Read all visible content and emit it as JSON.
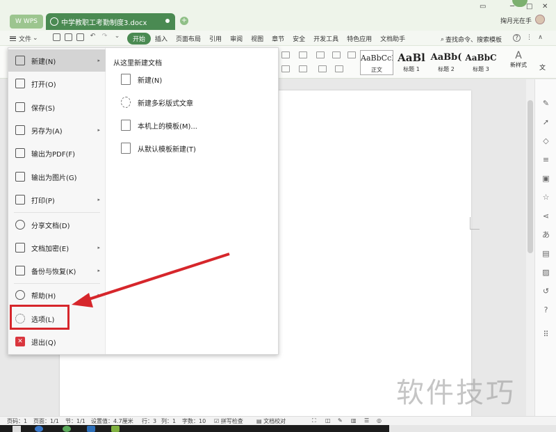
{
  "titlebar": {
    "wps_label": "WPS",
    "doc_tab_title": "中学教职工考勤制度3.docx",
    "add_tab": "+",
    "user_name": "掬月光在手",
    "win_min": "─",
    "win_max": "□",
    "win_close": "✕"
  },
  "menu": {
    "file_label": "文件",
    "tabs": [
      "开始",
      "插入",
      "页面布局",
      "引用",
      "审阅",
      "视图",
      "章节",
      "安全",
      "开发工具",
      "特色应用",
      "文档助手"
    ],
    "search_label": "查找命令、搜索模板",
    "help": "?",
    "more": "文"
  },
  "ribbon": {
    "styles": [
      {
        "preview": "AaBbCcDd",
        "caption": "正文"
      },
      {
        "preview": "AaBl",
        "caption": "标题 1"
      },
      {
        "preview": "AaBb(",
        "caption": "标题 2"
      },
      {
        "preview": "AaBbC",
        "caption": "标题 3"
      }
    ],
    "new_style": {
      "icon": "A",
      "caption": "新样式"
    }
  },
  "file_menu": {
    "items": [
      {
        "label": "新建(N)",
        "icon": "new-doc-icon",
        "arrow": true
      },
      {
        "label": "打开(O)",
        "icon": "folder-icon",
        "arrow": false
      },
      {
        "label": "保存(S)",
        "icon": "save-icon",
        "arrow": false
      },
      {
        "label": "另存为(A)",
        "icon": "save-as-icon",
        "arrow": true
      },
      {
        "label": "输出为PDF(F)",
        "icon": "pdf-icon",
        "arrow": false
      },
      {
        "label": "输出为图片(G)",
        "icon": "image-icon",
        "arrow": false
      },
      {
        "label": "打印(P)",
        "icon": "print-icon",
        "arrow": true
      },
      {
        "label": "分享文档(D)",
        "icon": "share-icon",
        "arrow": false
      },
      {
        "label": "文档加密(E)",
        "icon": "lock-icon",
        "arrow": true
      },
      {
        "label": "备份与恢复(K)",
        "icon": "backup-icon",
        "arrow": true
      },
      {
        "label": "帮助(H)",
        "icon": "help-icon",
        "arrow": true
      },
      {
        "label": "选项(L)",
        "icon": "gear-icon",
        "arrow": false
      },
      {
        "label": "退出(Q)",
        "icon": "close-icon",
        "arrow": false
      }
    ],
    "panel_title": "从这里新建文档",
    "panel_items": [
      {
        "label": "新建(N)"
      },
      {
        "label": "新建多彩版式文章"
      },
      {
        "label": "本机上的模板(M)..."
      },
      {
        "label": "从默认模板新建(T)"
      }
    ]
  },
  "statusbar": {
    "page_code": "页码：1",
    "pages": "页面：1/1",
    "section": "节：1/1",
    "setting": "设置值：4.7厘米",
    "row": "行：3",
    "col": "列：1",
    "words": "字数：10",
    "spell": "拼写检查",
    "proof": "文档校对"
  },
  "watermark": "软件技巧",
  "colors": {
    "accent": "#4a8a52",
    "highlight_red": "#d6262b",
    "menu_hover": "#d4d4d4"
  }
}
